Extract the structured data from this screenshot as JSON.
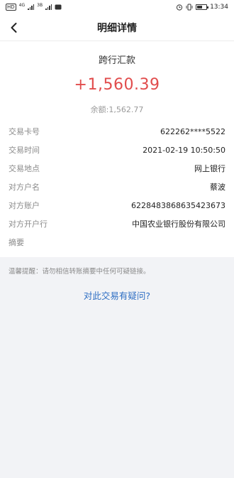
{
  "status_bar": {
    "left_badge": "HD",
    "net_label": "4G",
    "speed_label": "3B",
    "time": "13:34"
  },
  "header": {
    "title": "明细详情"
  },
  "transaction": {
    "type": "跨行汇款",
    "amount": "+1,560.39",
    "balance": "余额:1,562.77",
    "amount_color": "#e14c4c"
  },
  "details": [
    {
      "label": "交易卡号",
      "value": "622262****5522"
    },
    {
      "label": "交易时间",
      "value": "2021-02-19 10:50:50"
    },
    {
      "label": "交易地点",
      "value": "网上银行"
    },
    {
      "label": "对方户名",
      "value": "蔡波"
    },
    {
      "label": "对方账户",
      "value": "6228483868635423673"
    },
    {
      "label": "对方开户行",
      "value": "中国农业银行股份有限公司"
    },
    {
      "label": "摘要",
      "value": ""
    }
  ],
  "tip": "温馨提醒：请勿相信转账摘要中任何可疑链接。",
  "question_link": "对此交易有疑问?",
  "link_color": "#2f6fc4"
}
